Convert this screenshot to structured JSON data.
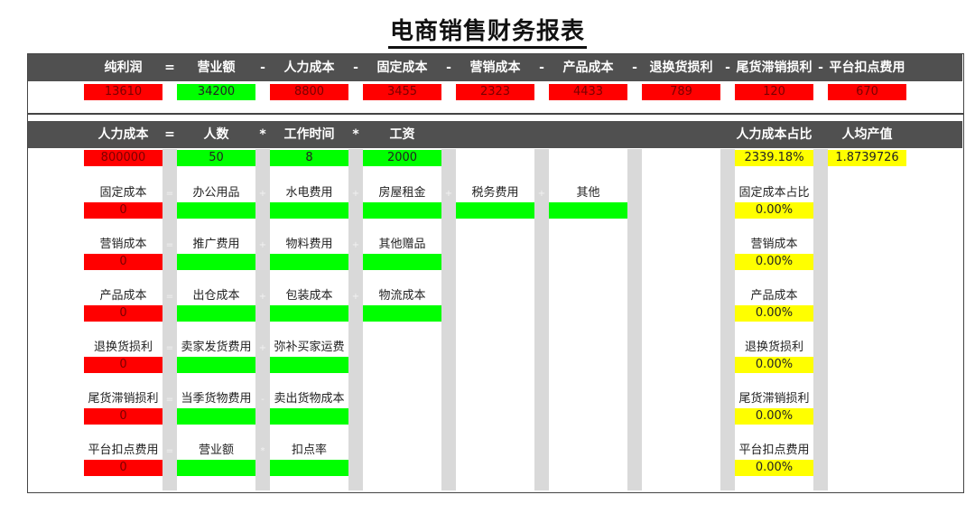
{
  "title": "电商销售财务报表",
  "summary": {
    "headers": [
      "纯利润",
      "营业额",
      "人力成本",
      "固定成本",
      "营销成本",
      "产品成本",
      "退换货损利",
      "尾货滞销损利",
      "平台扣点费用"
    ],
    "operators": [
      "=",
      "-",
      "-",
      "-",
      "-",
      "-",
      "-",
      "-"
    ],
    "values": [
      "13610",
      "34200",
      "8800",
      "3455",
      "2323",
      "4433",
      "789",
      "120",
      "670"
    ]
  },
  "detail": {
    "headers": [
      "人力成本",
      "人数",
      "工作时间",
      "工资"
    ],
    "operators": [
      "=",
      "*",
      "*"
    ],
    "right_headers": [
      "人力成本占比",
      "人均产值"
    ],
    "labor_values": [
      "800000",
      "50",
      "8",
      "2000"
    ],
    "labor_ratio": "2339.18%",
    "per_capita_output": "1.8739726",
    "rows": [
      {
        "name": "固定成本",
        "value": "0",
        "items": [
          "办公用品",
          "水电费用",
          "房屋租金",
          "税务费用",
          "其他"
        ],
        "ops": [
          "=",
          "+",
          "+",
          "+",
          "+"
        ],
        "ratio_label": "固定成本占比",
        "ratio": "0.00%"
      },
      {
        "name": "营销成本",
        "value": "0",
        "items": [
          "推广费用",
          "物料费用",
          "其他赠品"
        ],
        "ops": [
          "=",
          "+",
          "+"
        ],
        "ratio_label": "营销成本",
        "ratio": "0.00%"
      },
      {
        "name": "产品成本",
        "value": "0",
        "items": [
          "出仓成本",
          "包装成本",
          "物流成本"
        ],
        "ops": [
          "=",
          "+",
          "+"
        ],
        "ratio_label": "产品成本",
        "ratio": "0.00%"
      },
      {
        "name": "退换货损利",
        "value": "0",
        "items": [
          "卖家发货费用",
          "弥补买家运费"
        ],
        "ops": [
          "=",
          "+"
        ],
        "ratio_label": "退换货损利",
        "ratio": "0.00%"
      },
      {
        "name": "尾货滞销损利",
        "value": "0",
        "items": [
          "当季货物费用",
          "卖出货物成本"
        ],
        "ops": [
          "=",
          "-"
        ],
        "ratio_label": "尾货滞销损利",
        "ratio": "0.00%"
      },
      {
        "name": "平台扣点费用",
        "value": "0",
        "items": [
          "营业额",
          "扣点率"
        ],
        "ops": [
          "=",
          "*"
        ],
        "ratio_label": "平台扣点费用",
        "ratio": "0.00%"
      }
    ]
  },
  "colors": {
    "header_bg": "#505050",
    "negative": "#ff0000",
    "input": "#00ff00",
    "ratio": "#ffff00",
    "separator": "#d9d9d9"
  }
}
